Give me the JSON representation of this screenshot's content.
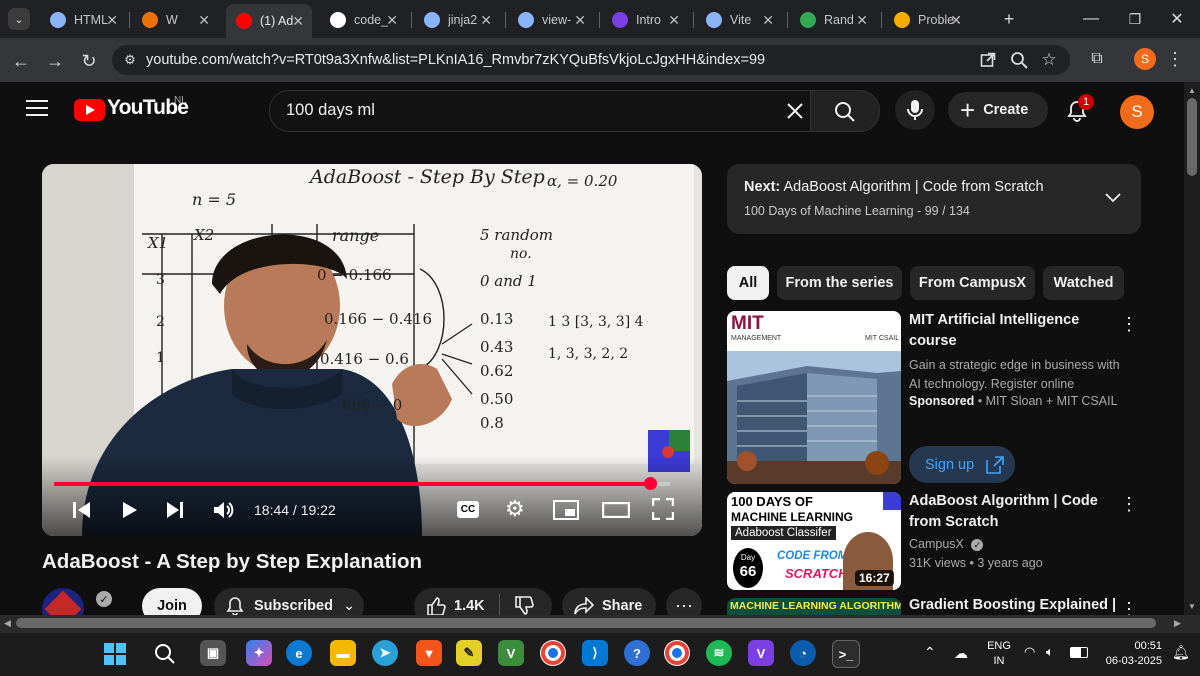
{
  "browser": {
    "tabs": [
      {
        "label": "HTML",
        "favicon": "globe-icon",
        "color": "#8ab4f8"
      },
      {
        "label": "W",
        "favicon": "s-icon",
        "color": "#e8710a"
      },
      {
        "label": "(1) Ad",
        "favicon": "youtube-icon",
        "color": "#ff0000",
        "active": true
      },
      {
        "label": "code_",
        "favicon": "github-icon",
        "color": "#ffffff"
      },
      {
        "label": "jinja2",
        "favicon": "terminal-icon",
        "color": "#8ab4f8"
      },
      {
        "label": "view-",
        "favicon": "globe-icon",
        "color": "#8ab4f8"
      },
      {
        "label": "Intro",
        "favicon": "b-icon",
        "color": "#7b3fe4"
      },
      {
        "label": "Vite",
        "favicon": "globe-icon",
        "color": "#8ab4f8"
      },
      {
        "label": "Rand",
        "favicon": "link-icon",
        "color": "#34a853"
      },
      {
        "label": "Proble",
        "favicon": "medal-icon",
        "color": "#f9ab00"
      }
    ],
    "new_tab": "+",
    "url": "youtube.com/watch?v=RT0t9a3Xnfw&list=PLKnIA16_Rmvbr7zKYQuBfsVkjoLcJgxHH&index=99",
    "profile_initial": "S"
  },
  "youtube": {
    "logo_text": "YouTube",
    "country": "NL",
    "search_value": "100 days ml",
    "create_label": "Create",
    "notification_count": "1",
    "avatar_initial": "S",
    "player": {
      "time": "18:44 / 19:22",
      "progress": 0.967,
      "board": {
        "title": "AdaBoost - Step By Step",
        "alpha": "α, = 0.20",
        "n": "n = 5",
        "col_x1": "X1",
        "col_x2": "X2",
        "col_range": "range",
        "rows_left": [
          "3",
          "2",
          "1"
        ],
        "ranges": [
          "0 − 0.166",
          "0.166 − 0.416",
          "0.416 − 0.6",
          "666 − 0"
        ],
        "random_heading": "5 random",
        "random_heading2": "no.",
        "between": "0 and 1",
        "randoms": [
          "0.13",
          "0.43",
          "0.62",
          "0.50",
          "0.8"
        ],
        "bucket": "1 3 [3, 3, 3] 4",
        "sequence": "1, 3, 3, 2, 2"
      }
    },
    "video_title": "AdaBoost - A Step by Step Explanation",
    "join_label": "Join",
    "subscribed_label": "Subscribed",
    "likes": "1.4K",
    "share_label": "Share",
    "next": {
      "prefix": "Next:",
      "title": "AdaBoost Algorithm | Code from Scratch",
      "playlist": "100 Days of Machine Learning",
      "position": "99 / 134"
    },
    "chips": [
      "All",
      "From the series",
      "From CampusX",
      "Watched"
    ],
    "ad": {
      "title": "MIT Artificial Intelligence course",
      "description": "Gain a strategic edge in business with AI technology. Register online",
      "sponsored": "Sponsored",
      "advertiser": "MIT Sloan + MIT CSAIL",
      "signup_label": "Sign up",
      "thumb_brand": "MIT",
      "thumb_sub": "MANAGEMENT",
      "thumb_csail": "MIT CSAIL"
    },
    "recs": [
      {
        "title": "AdaBoost Algorithm | Code from Scratch",
        "channel": "CampusX",
        "views": "31K views",
        "age": "3 years ago",
        "duration": "16:27",
        "thumb_line1": "100 DAYS OF",
        "thumb_line2": "MACHINE LEARNING",
        "thumb_line3": "Adaboost Classifer",
        "thumb_day": "Day",
        "thumb_day_num": "66",
        "thumb_code": "CODE FROM",
        "thumb_scratch": "SCRATCH"
      },
      {
        "title": "Gradient Boosting Explained |",
        "thumb_text": "MACHINE LEARNING ALGORITHMS"
      }
    ]
  },
  "taskbar": {
    "lang": "ENG",
    "region": "IN",
    "time": "00:51",
    "date": "06-03-2025"
  },
  "colors": {
    "accent_red": "#ff0000",
    "progress_red": "#ff0033",
    "avatar_orange": "#f26b1d",
    "link_blue": "#3ea6ff"
  }
}
